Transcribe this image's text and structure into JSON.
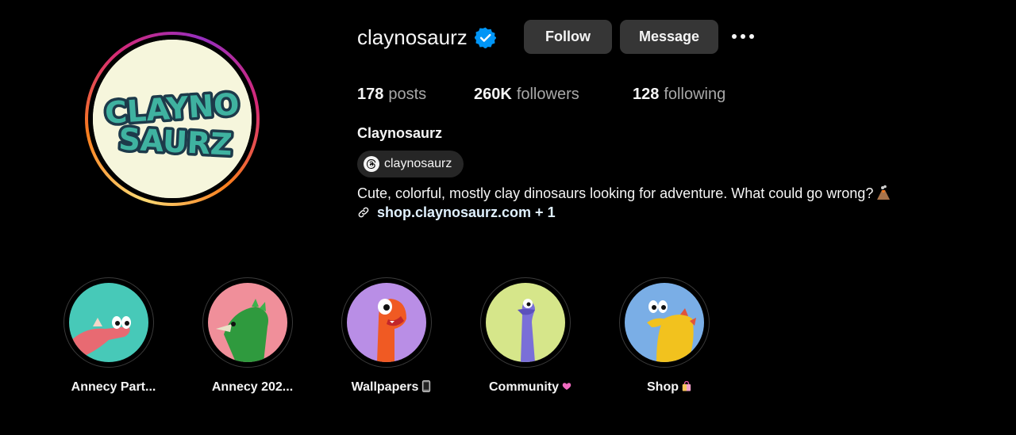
{
  "profile": {
    "username": "claynosaurz",
    "verified_icon": "verified-badge-icon",
    "avatar_text_line1": "CLAYNO",
    "avatar_text_line2": "SAURZ",
    "follow_label": "Follow",
    "message_label": "Message",
    "more_icon": "more-options-icon"
  },
  "stats": {
    "posts_count": "178",
    "posts_label": "posts",
    "followers_count": "260K",
    "followers_label": "followers",
    "following_count": "128",
    "following_label": "following"
  },
  "bio": {
    "full_name": "Claynosaurz",
    "threads_handle": "claynosaurz",
    "text": "Cute, colorful, mostly clay dinosaurs looking for adventure. What could go wrong?",
    "link": "shop.claynosaurz.com + 1"
  },
  "highlights": [
    {
      "label": "Annecy Part...",
      "emoji": "",
      "bg": "#47c9b8",
      "dino": "#e86a72"
    },
    {
      "label": "Annecy 202...",
      "emoji": "",
      "bg": "#f08f9a",
      "dino": "#2f9a3e"
    },
    {
      "label": "Wallpapers",
      "emoji": "phone-icon",
      "bg": "#b98ee6",
      "dino": "#f05a23"
    },
    {
      "label": "Community",
      "emoji": "heart-icon",
      "bg": "#d6e68a",
      "dino": "#7a6fd8"
    },
    {
      "label": "Shop",
      "emoji": "shopping-bag-icon",
      "bg": "#7aaee6",
      "dino": "#f2c21e"
    }
  ],
  "colors": {
    "background": "#000000",
    "button": "#363636",
    "verified": "#0095f6",
    "link": "#e0f1ff"
  }
}
